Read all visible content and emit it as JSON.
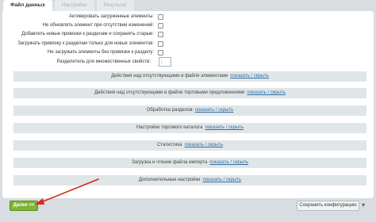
{
  "tabs": [
    {
      "label": "Файл данных"
    },
    {
      "label": "Настройки"
    },
    {
      "label": "Результат"
    }
  ],
  "options": [
    {
      "label": "Активировать загруженные элементы:"
    },
    {
      "label": "Не обновлять элемент при отсутствии изменений:"
    },
    {
      "label": "Добавлять новые привязки к разделам и сохранять старые:"
    },
    {
      "label": "Загружать привязку к разделам только для новых элементов:"
    },
    {
      "label": "Не загружать элементы без привязки к разделу:"
    }
  ],
  "separator": {
    "label": "Разделитель для множественных свойств:",
    "value": ";"
  },
  "sections": [
    {
      "title": "Действия над отсутствующими в файле элементами",
      "link": "показать / скрыть"
    },
    {
      "title": "Действия над отсутствующими в файле торговыми предложениями",
      "link": "показать / скрыть"
    },
    {
      "title": "Обработка разделов",
      "link": "показать / скрыть"
    },
    {
      "title": "Настройки торгового каталога",
      "link": "показать / скрыть"
    },
    {
      "title": "Статистика",
      "link": "показать / скрыть"
    },
    {
      "title": "Загрузка и чтение файла импорта",
      "link": "показать / скрыть"
    },
    {
      "title": "Дополнительные настройки",
      "link": "показать / скрыть"
    }
  ],
  "footer": {
    "next_label": "Далее >>",
    "save_label": "Сохранить конфигурацию",
    "more_icon": "chevron-down-icon"
  },
  "colors": {
    "next_button": "#7fb334",
    "annotation_arrow": "#d42b1e",
    "link": "#2f6fa3"
  }
}
